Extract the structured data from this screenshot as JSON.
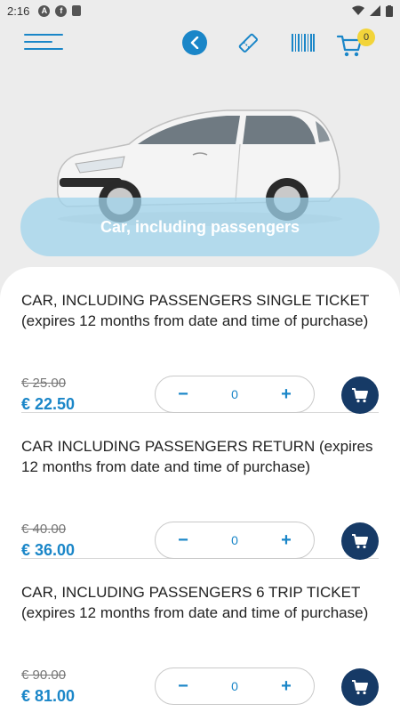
{
  "status_bar": {
    "time": "2:16"
  },
  "header": {
    "cart_count": "0"
  },
  "hero": {
    "title": "Car, including passengers"
  },
  "tickets": [
    {
      "title": "CAR, INCLUDING PASSENGERS SINGLE TICKET (expires 12 months from date and time of purchase)",
      "old_price": "€ 25.00",
      "price": "€ 22.50",
      "quantity": "0"
    },
    {
      "title": "CAR INCLUDING PASSENGERS RETURN (expires 12 months from date and time of purchase)",
      "old_price": "€ 40.00",
      "price": "€ 36.00",
      "quantity": "0"
    },
    {
      "title": "CAR, INCLUDING PASSENGERS 6 TRIP TICKET (expires 12 months from date and time of purchase)",
      "old_price": "€ 90.00",
      "price": "€ 81.00",
      "quantity": "0"
    }
  ],
  "stepper": {
    "minus": "−",
    "plus": "+"
  },
  "colors": {
    "accent": "#1a86c8",
    "cart_button": "#163a66",
    "badge": "#f2d43a"
  }
}
